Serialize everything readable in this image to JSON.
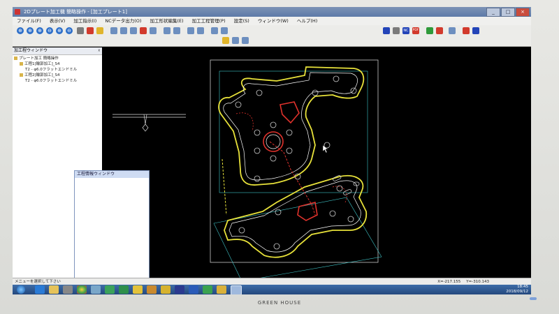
{
  "window": {
    "title": "2Dプレート加工機 簡略操作 - [加工プレート1]",
    "controls": {
      "minimize": "_",
      "maximize": "□",
      "close": "×"
    }
  },
  "menu": [
    "ファイル(F)",
    "表示(V)",
    "加工指示(I)",
    "NCデータ出力(O)",
    "加工形状編集(E)",
    "加工工程管理(P)",
    "設定(S)",
    "ウィンドウ(W)",
    "ヘルプ(H)"
  ],
  "toolbar": {
    "zoom_labels": [
      "⊕",
      "⊕",
      "⊕",
      "⊖",
      "⊕",
      "⊖"
    ],
    "nc_label": "NC",
    "pdf_label": "PDF"
  },
  "tree_panel": {
    "title": "加工程ウィンドウ",
    "pin": "ᵡ",
    "items": [
      "プレート加工 簡略操作",
      "工程1[輪郭加工]_S4",
      "T2 - φ6.0フラットエンドミル",
      "工程2[輪郭加工]_S4",
      "T2 - φ6.0フラットエンドミル"
    ]
  },
  "property_window": {
    "title": "工程情報ウィンドウ"
  },
  "status": {
    "message": "メニューを選択して下さい",
    "x_coord": "X=-217.155",
    "y_coord": "Y=-310.143"
  },
  "tray": {
    "time": "18:45",
    "date": "2018/09/12"
  },
  "monitor_brand": "GREEN HOUSE",
  "colors": {
    "part_outline": "#e8e23a",
    "toolpath": "#ffffff",
    "stock_outline": "#3fc5c8",
    "cut_path": "#e0322c",
    "canvas_bg": "#000000"
  }
}
